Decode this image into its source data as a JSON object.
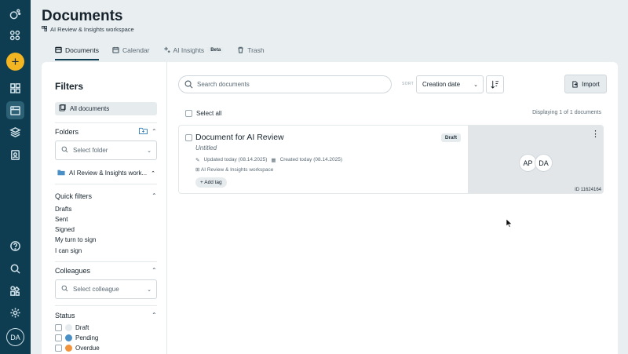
{
  "app": {
    "page_title": "Documents",
    "workspace_name": "AI Review & Insights workspace",
    "avatar_initials": "DA",
    "create_symbol": "+"
  },
  "tabs": [
    {
      "label": "Documents",
      "icon": "documents-icon",
      "active": true
    },
    {
      "label": "Calendar",
      "icon": "calendar-icon"
    },
    {
      "label": "AI Insights",
      "icon": "sparkle-icon",
      "badge": "Beta"
    },
    {
      "label": "Trash",
      "icon": "trash-icon"
    }
  ],
  "filters": {
    "title": "Filters",
    "all_documents": "All documents",
    "folders_title": "Folders",
    "folder_placeholder": "Select folder",
    "folder_item": "AI Review & Insights work...",
    "quick_filters_title": "Quick filters",
    "quick_filters": [
      "Drafts",
      "Sent",
      "Signed",
      "My turn to sign",
      "I can sign"
    ],
    "colleagues_title": "Colleagues",
    "colleague_placeholder": "Select colleague",
    "status_title": "Status",
    "statuses": [
      {
        "label": "Draft",
        "color": "#e6ebee"
      },
      {
        "label": "Pending",
        "color": "#4a8fc6"
      },
      {
        "label": "Overdue",
        "color": "#f0933a"
      }
    ]
  },
  "toolbar": {
    "search_placeholder": "Search documents",
    "sort_label": "SORT",
    "sort_value": "Creation date",
    "import_label": "Import"
  },
  "list": {
    "select_all": "Select all",
    "displaying": "Displaying 1 of 1 documents"
  },
  "document": {
    "title": "Document for AI Review",
    "badge": "Draft",
    "subtitle": "Untitled",
    "updated": "Updated today (08.14.2025)",
    "created": "Created today (08.14.2025)",
    "workspace": "AI Review & Insights workspace",
    "add_tag": "+ Add tag",
    "participants": [
      "AP",
      "DA"
    ],
    "id_label": "ID 11624164",
    "more_symbol": "⋮"
  },
  "colors": {
    "rail": "#0e3d52",
    "accent": "#f3b521"
  }
}
